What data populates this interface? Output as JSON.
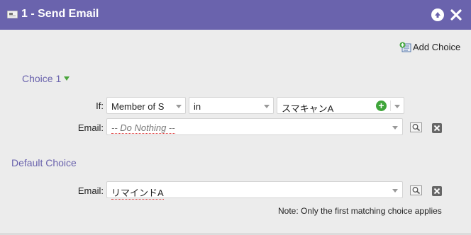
{
  "window": {
    "title": "1 - Send Email"
  },
  "actions": {
    "add_choice_label": "Add Choice"
  },
  "choice1": {
    "title": "Choice 1",
    "if_label": "If:",
    "condition_field": "Member of S",
    "operator": "in",
    "value": "スマキャンA",
    "email_label": "Email:",
    "email_placeholder": "-- Do Nothing --"
  },
  "default_choice": {
    "title": "Default Choice",
    "email_label": "Email:",
    "email_value": "リマインドA"
  },
  "footer": {
    "note": "Note: Only the first matching choice applies"
  },
  "colors": {
    "header": "#6a63ad",
    "section_title": "#6a63ad",
    "add_green": "#3fa53a"
  },
  "icons": {
    "title": "email-window-icon",
    "collapse": "collapse-up-icon",
    "close": "close-icon",
    "add_choice": "add-choice-icon",
    "preview": "preview-icon",
    "remove": "remove-icon"
  }
}
